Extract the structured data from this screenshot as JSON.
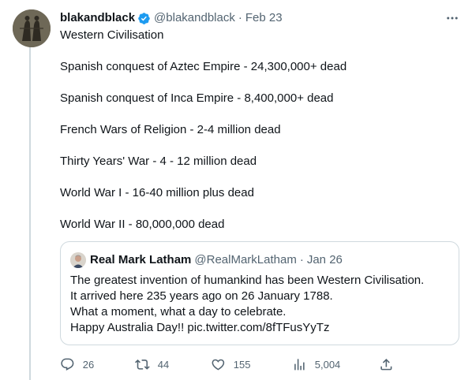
{
  "tweet": {
    "display_name": "blakandblack",
    "handle": "@blakandblack",
    "separator": "·",
    "date": "Feb 23",
    "text_lines": [
      "Western Civilisation",
      "",
      "Spanish conquest of Aztec Empire - 24,300,000+ dead",
      "",
      "Spanish conquest of Inca Empire - 8,400,000+ dead",
      "",
      "French Wars of Religion - 2-4 million dead",
      "",
      "Thirty Years' War - 4 - 12 million dead",
      "",
      "World War I - 16-40 million plus dead",
      "",
      "World War II - 80,000,000 dead"
    ],
    "verified": true,
    "accent_color": "#1d9bf0",
    "secondary_text_color": "#536471"
  },
  "quote": {
    "display_name": "Real Mark Latham",
    "handle": "@RealMarkLatham",
    "separator": "·",
    "date": "Jan 26",
    "text_lines": [
      "The greatest invention of humankind has been Western Civilisation.",
      "It arrived here 235 years ago on 26 January 1788.",
      "What a moment, what a day to celebrate.",
      "Happy Australia Day!! pic.twitter.com/8fTFusYyTz"
    ]
  },
  "actions": {
    "replies": "26",
    "retweets": "44",
    "likes": "155",
    "views": "5,004"
  },
  "icons": {
    "verified": "verified-badge-icon",
    "more": "more-horizontal-icon",
    "reply": "reply-icon",
    "retweet": "retweet-icon",
    "like": "heart-icon",
    "views": "views-chart-icon",
    "share": "share-icon"
  }
}
